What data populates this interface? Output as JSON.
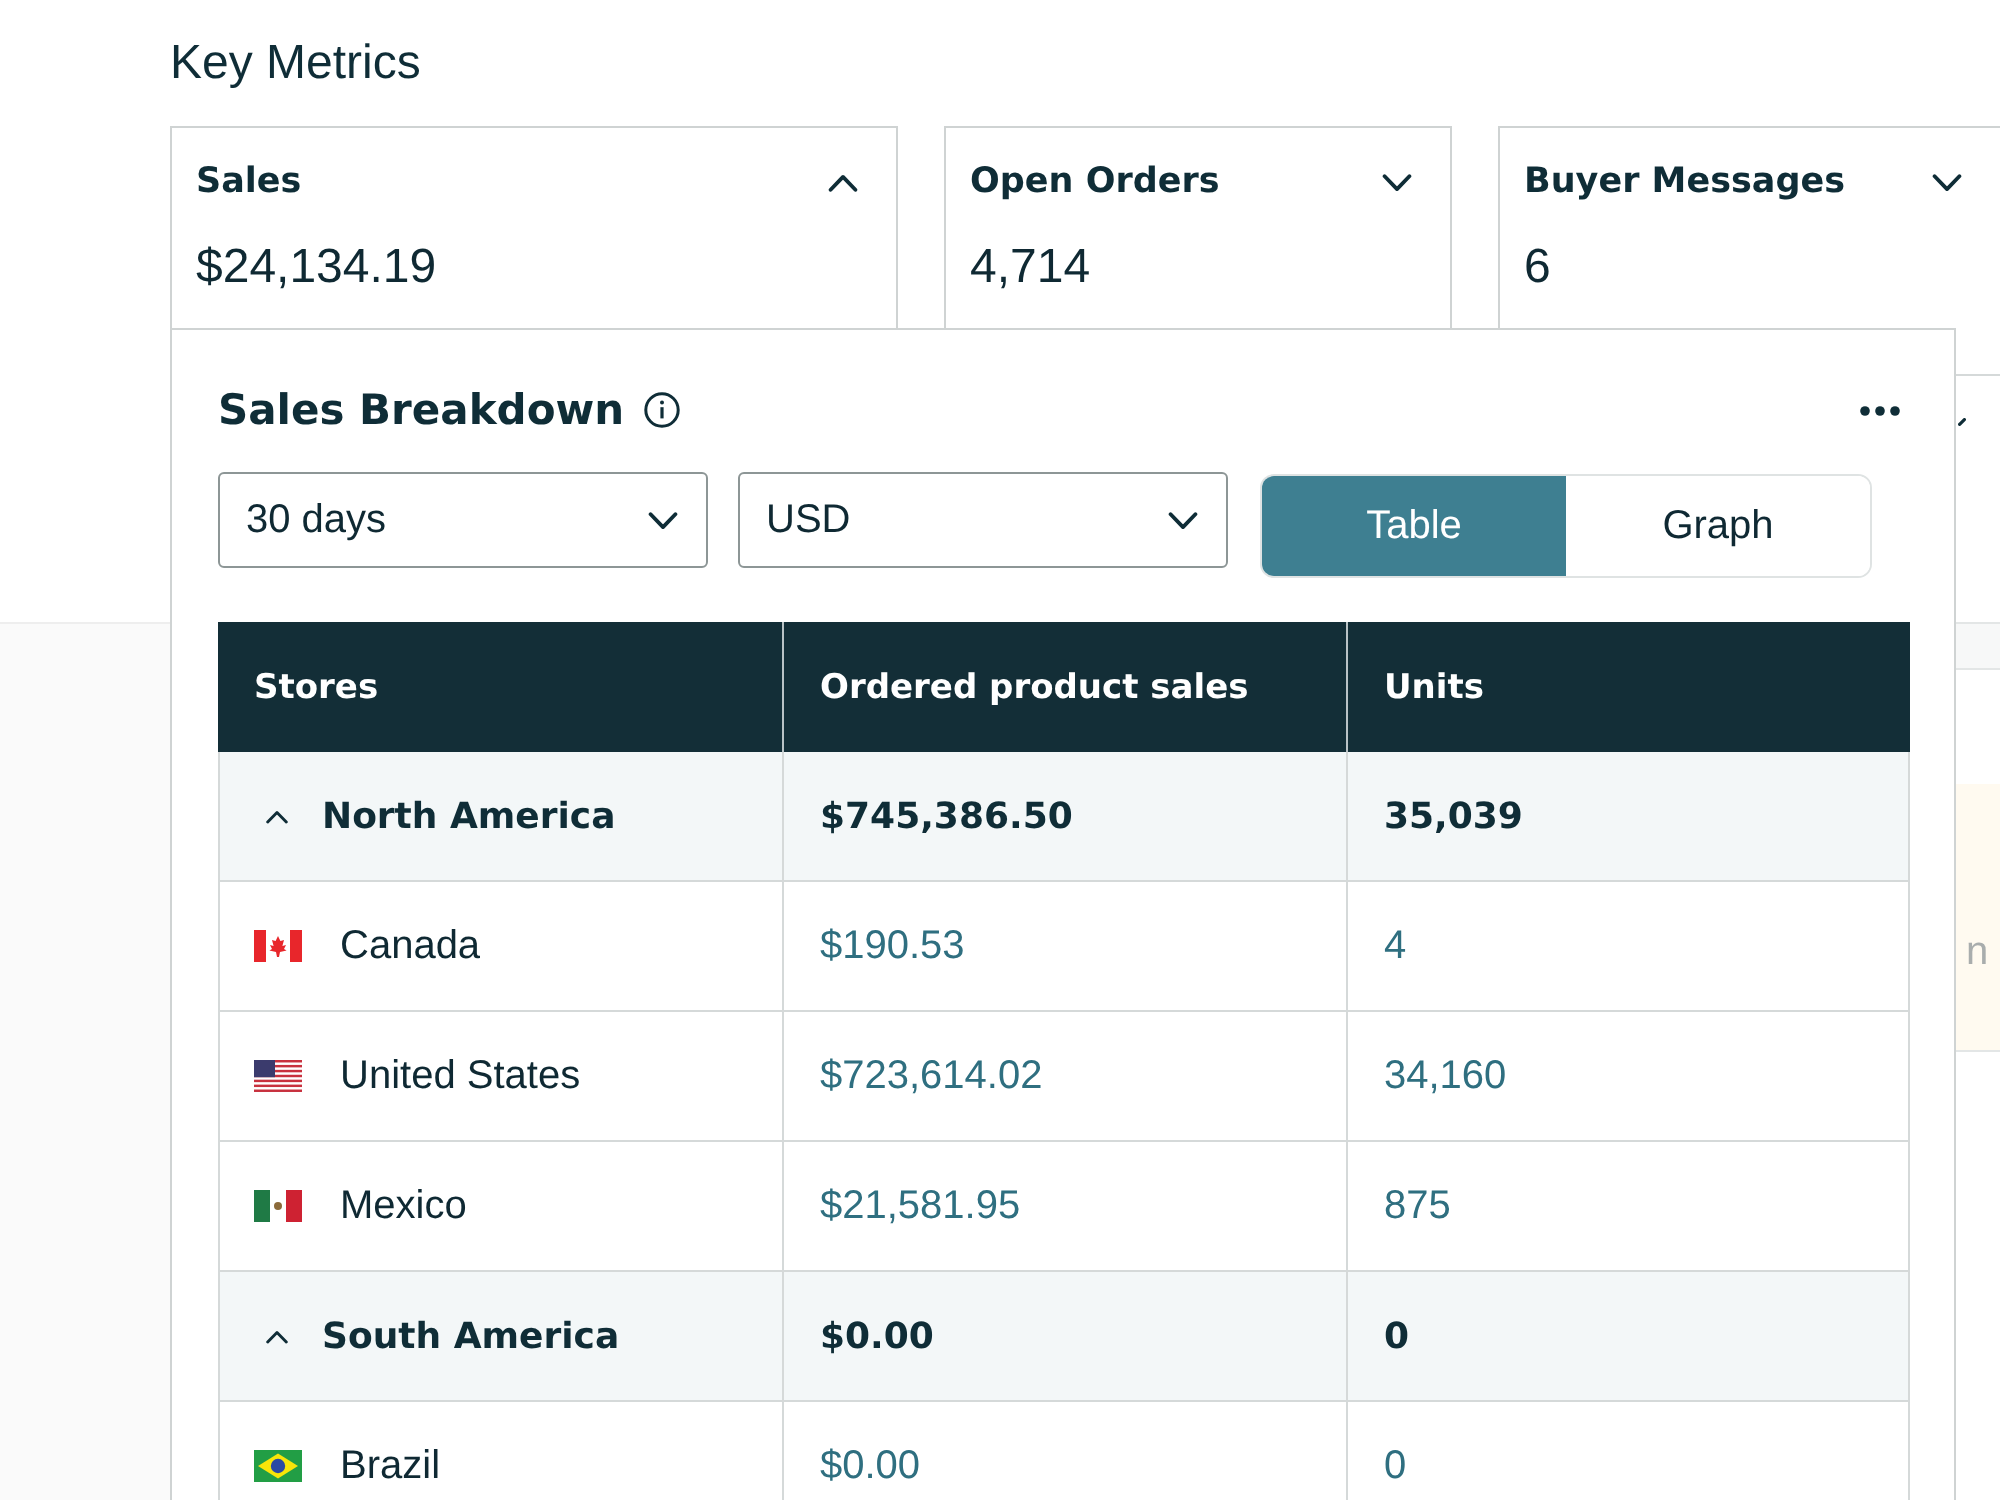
{
  "page": {
    "title": "Key Metrics"
  },
  "metric_cards": [
    {
      "title": "Sales",
      "value": "$24,134.19",
      "expanded": true
    },
    {
      "title": "Open Orders",
      "value": "4,714",
      "expanded": false
    },
    {
      "title": "Buyer Messages",
      "value": "6",
      "expanded": false
    }
  ],
  "breakdown": {
    "title": "Sales Breakdown",
    "filters": [
      {
        "value": "30 days"
      },
      {
        "value": "USD"
      }
    ],
    "view_toggle": [
      {
        "label": "Table",
        "selected": true
      },
      {
        "label": "Graph",
        "selected": false
      }
    ],
    "table": {
      "columns": [
        "Stores",
        "Ordered product sales",
        "Units"
      ],
      "groups": [
        {
          "name": "North America",
          "sales": "$745,386.50",
          "units": "35,039",
          "expanded": true,
          "children": [
            {
              "name": "Canada",
              "kind": "canada",
              "sales": "$190.53",
              "units": "4"
            },
            {
              "name": "United States",
              "kind": "usa",
              "sales": "$723,614.02",
              "units": "34,160"
            },
            {
              "name": "Mexico",
              "kind": "mexico",
              "sales": "$21,581.95",
              "units": "875"
            }
          ]
        },
        {
          "name": "South America",
          "sales": "$0.00",
          "units": "0",
          "expanded": true,
          "children": [
            {
              "name": "Brazil",
              "kind": "brazil",
              "sales": "$0.00",
              "units": "0"
            }
          ]
        }
      ]
    }
  },
  "side_panel": {
    "text": "n"
  }
}
